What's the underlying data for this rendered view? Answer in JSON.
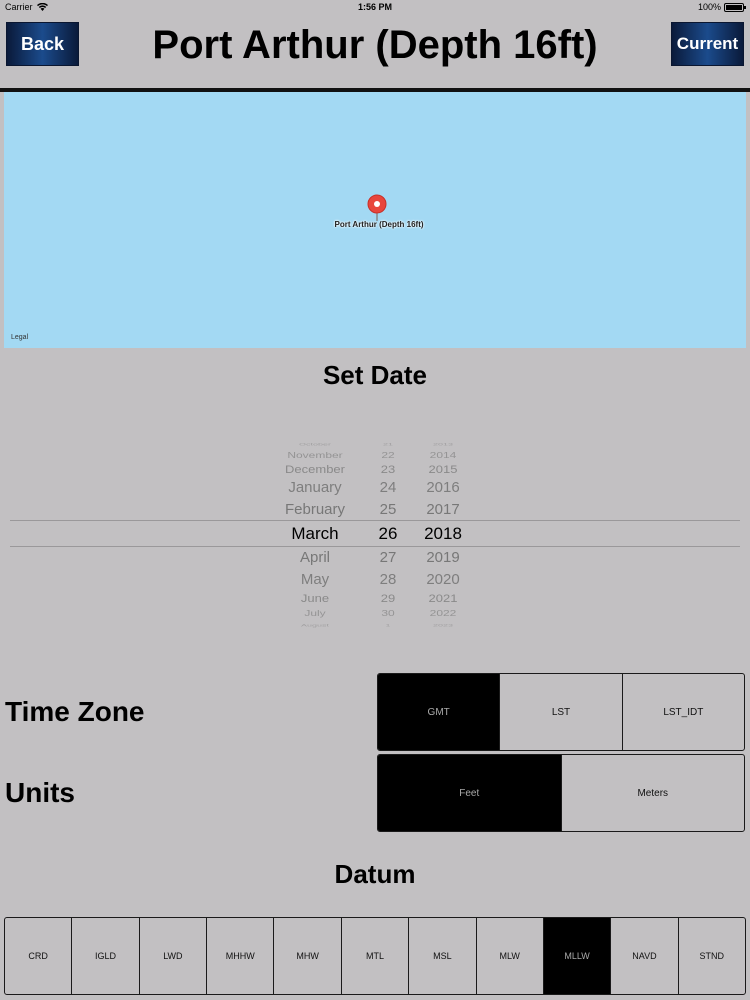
{
  "status": {
    "carrier": "Carrier",
    "time": "1:56 PM",
    "battery": "100%"
  },
  "nav": {
    "back_label": "Back",
    "title": "Port Arthur (Depth 16ft)",
    "current_label": "Current"
  },
  "map": {
    "pin_label": "Port Arthur (Depth 16ft)",
    "legal": "Legal"
  },
  "date_section": {
    "title": "Set Date",
    "rows": [
      {
        "month": "October",
        "day": "21",
        "year": "2013"
      },
      {
        "month": "November",
        "day": "22",
        "year": "2014"
      },
      {
        "month": "December",
        "day": "23",
        "year": "2015"
      },
      {
        "month": "January",
        "day": "24",
        "year": "2016"
      },
      {
        "month": "February",
        "day": "25",
        "year": "2017"
      },
      {
        "month": "March",
        "day": "26",
        "year": "2018"
      },
      {
        "month": "April",
        "day": "27",
        "year": "2019"
      },
      {
        "month": "May",
        "day": "28",
        "year": "2020"
      },
      {
        "month": "June",
        "day": "29",
        "year": "2021"
      },
      {
        "month": "July",
        "day": "30",
        "year": "2022"
      },
      {
        "month": "August",
        "day": "1",
        "year": "2023"
      }
    ],
    "selected": {
      "month": "March",
      "day": "26",
      "year": "2018"
    }
  },
  "time_zone": {
    "label": "Time Zone",
    "options": [
      "GMT",
      "LST",
      "LST_IDT"
    ],
    "selected": "GMT"
  },
  "units": {
    "label": "Units",
    "options": [
      "Feet",
      "Meters"
    ],
    "selected": "Feet"
  },
  "datum": {
    "title": "Datum",
    "options": [
      "CRD",
      "IGLD",
      "LWD",
      "MHHW",
      "MHW",
      "MTL",
      "MSL",
      "MLW",
      "MLLW",
      "NAVD",
      "STND"
    ],
    "selected": "MLLW"
  },
  "colors": {
    "background": "#c2c0c2",
    "map_water": "#a3d9f3",
    "pin": "#e8463c",
    "button_blue": "#1b4b8c",
    "segment_active": "#000000"
  }
}
